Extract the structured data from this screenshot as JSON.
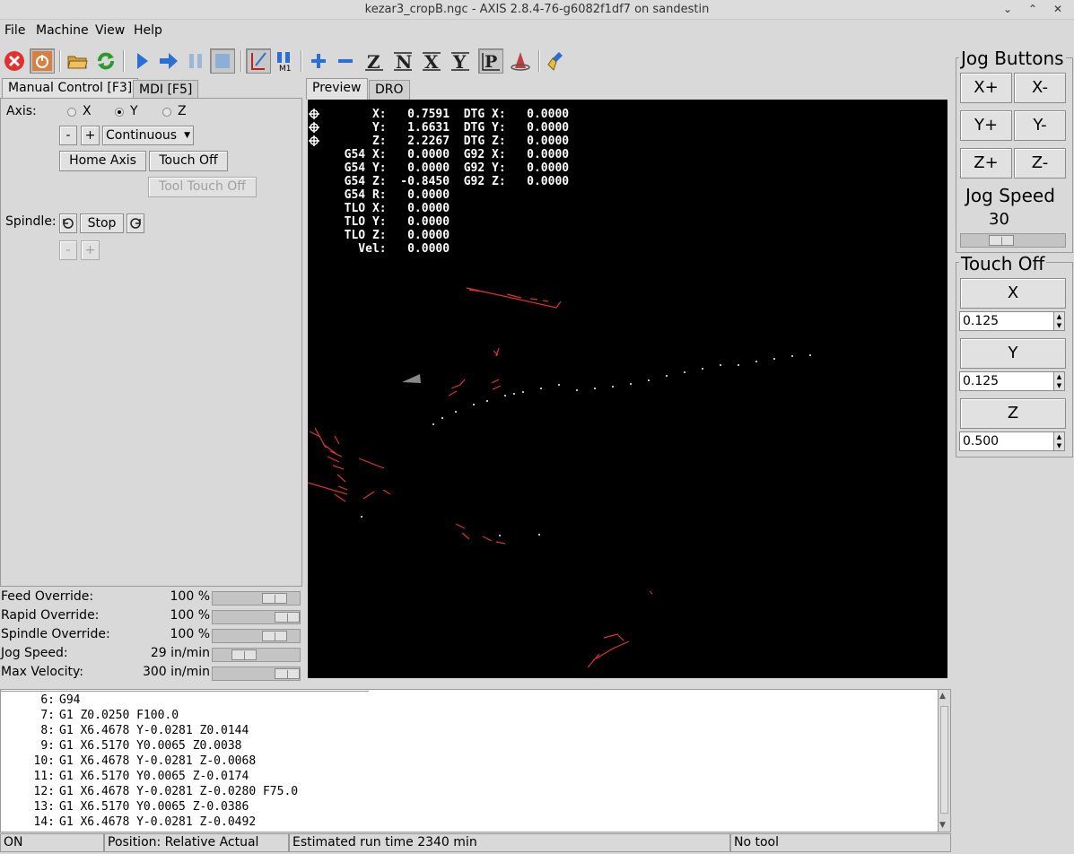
{
  "window": {
    "title": "kezar3_cropB.ngc - AXIS 2.8.4-76-g6082f1df7 on sandestin",
    "min": "⌄",
    "restore": "⌃",
    "close": "✕"
  },
  "menu": [
    "File",
    "Machine",
    "View",
    "Help"
  ],
  "toolbar": {
    "icons": [
      "estop-icon",
      "power-icon",
      "open-icon",
      "reload-icon",
      "run-icon",
      "step-icon",
      "pause-icon",
      "stop-icon",
      "block-delete-icon",
      "optional-stop-icon",
      "zoom-in-icon",
      "zoom-out-icon",
      "view-z-icon",
      "view-z2-icon",
      "view-x-icon",
      "view-y-icon",
      "view-p-icon",
      "rotate-view-icon",
      "clear-plot-icon"
    ],
    "colors": {
      "estop": "#e23030",
      "power": "#d88040",
      "run": "#2a6fd8"
    }
  },
  "tabs_left": [
    "Manual Control [F3]",
    "MDI [F5]"
  ],
  "manual": {
    "axis_label": "Axis:",
    "axes": [
      "X",
      "Y",
      "Z"
    ],
    "selected_axis": "Y",
    "minus": "-",
    "plus": "+",
    "jog_mode": "Continuous",
    "home_axis": "Home Axis",
    "touch_off": "Touch Off",
    "tool_touch_off": "Tool Touch Off",
    "spindle_label": "Spindle:",
    "spindle_stop": "Stop",
    "spindle_minus": "-",
    "spindle_plus": "+"
  },
  "overrides": [
    {
      "label": "Feed Override:",
      "value": "100 %",
      "level": 0.8
    },
    {
      "label": "Rapid Override:",
      "value": "100 %",
      "level": 1.0
    },
    {
      "label": "Spindle Override:",
      "value": "100 %",
      "level": 0.8
    },
    {
      "label": "Jog Speed:",
      "value": "29 in/min",
      "level": 0.3
    },
    {
      "label": "Max Velocity:",
      "value": "300 in/min",
      "level": 1.0
    }
  ],
  "tabs_preview": [
    "Preview",
    "DRO"
  ],
  "dro": [
    "      X:   0.7591  DTG X:   0.0000",
    "      Y:   1.6631  DTG Y:   0.0000",
    "      Z:   2.2267  DTG Z:   0.0000",
    "  G54 X:   0.0000  G92 X:   0.0000",
    "  G54 Y:   0.0000  G92 Y:   0.0000",
    "  G54 Z:  -0.8450  G92 Z:   0.0000",
    "  G54 R:   0.0000",
    "  TLO X:   0.0000",
    "  TLO Y:   0.0000",
    "  TLO Z:   0.0000",
    "    Vel:   0.0000"
  ],
  "jog": {
    "title": "Jog Buttons",
    "buttons": [
      "X+",
      "X-",
      "Y+",
      "Y-",
      "Z+",
      "Z-"
    ],
    "speed_title": "Jog Speed",
    "speed_value": "30",
    "speed_level": 0.35
  },
  "touchoff": {
    "title": "Touch Off",
    "axes": [
      {
        "label": "X",
        "value": "0.125"
      },
      {
        "label": "Y",
        "value": "0.125"
      },
      {
        "label": "Z",
        "value": "0.500"
      }
    ]
  },
  "gcode": [
    {
      "n": "6:",
      "code": "G94"
    },
    {
      "n": "7:",
      "code": "G1 Z0.0250 F100.0"
    },
    {
      "n": "8:",
      "code": "G1 X6.4678 Y-0.0281 Z0.0144"
    },
    {
      "n": "9:",
      "code": "G1 X6.5170 Y0.0065 Z0.0038"
    },
    {
      "n": "10:",
      "code": "G1 X6.4678 Y-0.0281 Z-0.0068"
    },
    {
      "n": "11:",
      "code": "G1 X6.5170 Y0.0065 Z-0.0174"
    },
    {
      "n": "12:",
      "code": "G1 X6.4678 Y-0.0281 Z-0.0280 F75.0"
    },
    {
      "n": "13:",
      "code": "G1 X6.5170 Y0.0065 Z-0.0386"
    },
    {
      "n": "14:",
      "code": "G1 X6.4678 Y-0.0281 Z-0.0492"
    }
  ],
  "status": {
    "state": "ON",
    "position": "Position: Relative Actual",
    "runtime": "Estimated run time 2340 min",
    "tool": "No tool"
  }
}
